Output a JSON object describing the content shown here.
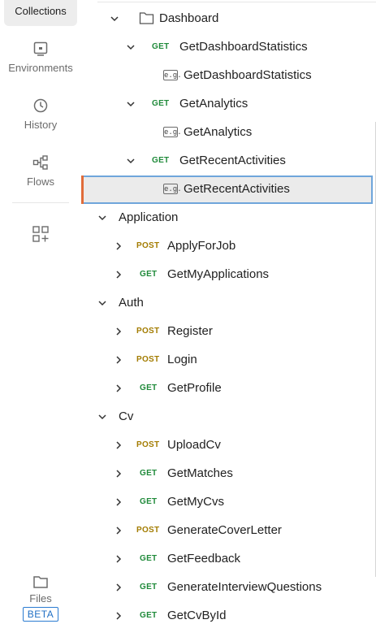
{
  "sidebar": {
    "active": "Collections",
    "items": [
      {
        "label": "Environments",
        "icon": "environments-icon"
      },
      {
        "label": "History",
        "icon": "history-icon"
      },
      {
        "label": "Flows",
        "icon": "flows-icon"
      }
    ],
    "more_icon": "add-grid-icon",
    "files": {
      "label": "Files",
      "badge": "BETA"
    }
  },
  "tree": {
    "folder": "Dashboard",
    "r1": {
      "method": "GET",
      "name": "GetDashboardStatistics",
      "example": "GetDashboardStatistics"
    },
    "r2": {
      "method": "GET",
      "name": "GetAnalytics",
      "example": "GetAnalytics"
    },
    "r3": {
      "method": "GET",
      "name": "GetRecentActivities",
      "example": "GetRecentActivities"
    },
    "eg_icon": "e.g.",
    "application": {
      "label": "Application",
      "items": [
        {
          "method": "POST",
          "name": "ApplyForJob"
        },
        {
          "method": "GET",
          "name": "GetMyApplications"
        }
      ]
    },
    "auth": {
      "label": "Auth",
      "items": [
        {
          "method": "POST",
          "name": "Register"
        },
        {
          "method": "POST",
          "name": "Login"
        },
        {
          "method": "GET",
          "name": "GetProfile"
        }
      ]
    },
    "cv": {
      "label": "Cv",
      "items": [
        {
          "method": "POST",
          "name": "UploadCv"
        },
        {
          "method": "GET",
          "name": "GetMatches"
        },
        {
          "method": "GET",
          "name": "GetMyCvs"
        },
        {
          "method": "POST",
          "name": "GenerateCoverLetter"
        },
        {
          "method": "GET",
          "name": "GetFeedback"
        },
        {
          "method": "GET",
          "name": "GenerateInterviewQuestions"
        },
        {
          "method": "GET",
          "name": "GetCvById"
        }
      ]
    }
  },
  "colors": {
    "get": "#1f8a3a",
    "post": "#a37c00",
    "selection": "#6fa6db",
    "accent": "#e06c3a"
  }
}
